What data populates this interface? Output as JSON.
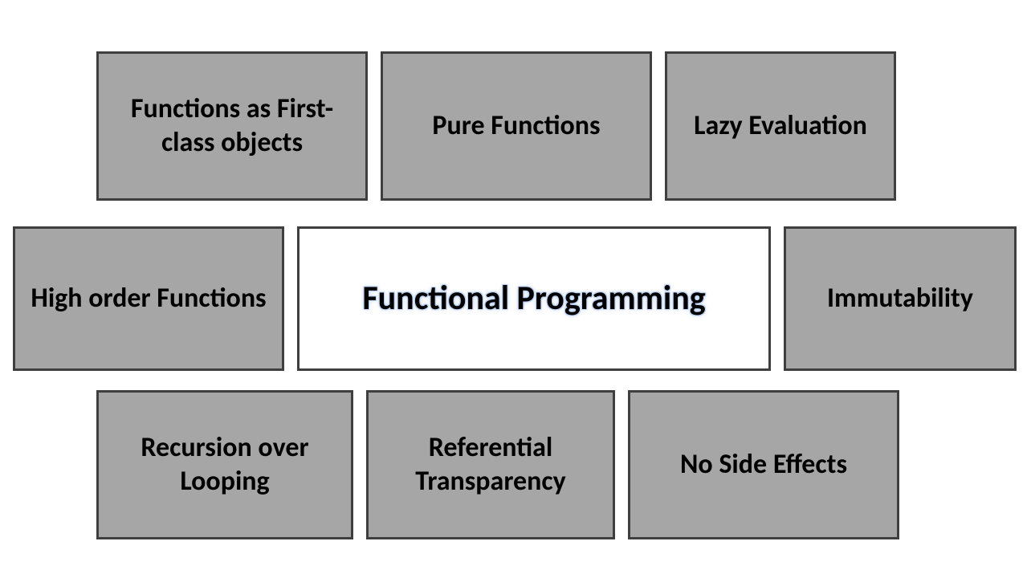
{
  "boxes": {
    "top": [
      "Functions as First-class objects",
      "Pure Functions",
      "Lazy Evaluation"
    ],
    "middle": {
      "left": "High order Functions",
      "center": "Functional Programming",
      "right": "Immutability"
    },
    "bottom": [
      "Recursion over Looping",
      "Referential Transparency",
      "No Side Effects"
    ]
  }
}
